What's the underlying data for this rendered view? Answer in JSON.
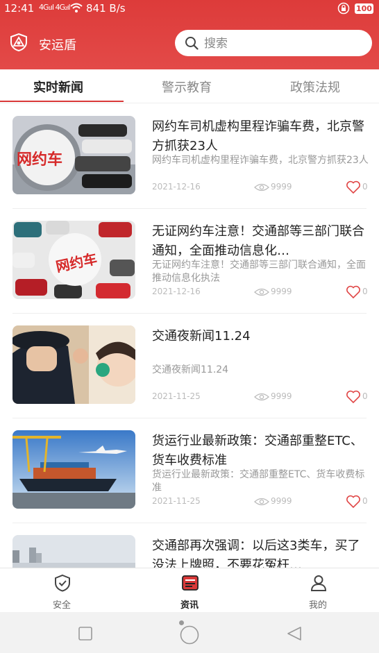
{
  "status_bar": {
    "time": "12:41",
    "signal": "4G₁ıl 4G₂ıl",
    "speed": "841 B/s",
    "battery": "100"
  },
  "header": {
    "app_name": "安运盾",
    "accent_color": "#dd3b3a",
    "logo_icon": "shield-logo-icon"
  },
  "search": {
    "placeholder": "搜索",
    "value": ""
  },
  "tabs": [
    {
      "label": "实时新闻",
      "active": true
    },
    {
      "label": "警示教育",
      "active": false
    },
    {
      "label": "政策法规",
      "active": false
    }
  ],
  "news": [
    {
      "title": "网约车司机虚构里程诈骗车费，北京警方抓获23人",
      "summary": "网约车司机虚构里程诈骗车费，北京警方抓获23人",
      "date": "2021-12-16",
      "views": "9999",
      "likes": "0",
      "thumb_text": "网约车"
    },
    {
      "title": "无证网约车注意！交通部等三部门联合通知，全面推动信息化…",
      "summary": "无证网约车注意！交通部等三部门联合通知，全面推动信息化执法",
      "date": "2021-12-16",
      "views": "9999",
      "likes": "0",
      "thumb_text": "网约车"
    },
    {
      "title": "交通夜新闻11.24",
      "summary": "交通夜新闻11.24",
      "date": "2021-11-25",
      "views": "9999",
      "likes": "0"
    },
    {
      "title": "货运行业最新政策：交通部重整ETC、货车收费标准",
      "summary": "货运行业最新政策：交通部重整ETC、货车收费标准",
      "date": "2021-11-25",
      "views": "9999",
      "likes": "0"
    },
    {
      "title": "交通部再次强调：以后这3类车，买了没法上牌照，不要花冤枉…",
      "summary": "",
      "date": "",
      "views": "",
      "likes": ""
    }
  ],
  "bottom_nav": [
    {
      "label": "安全",
      "icon": "shield-check-icon",
      "active": false
    },
    {
      "label": "资讯",
      "icon": "news-icon",
      "active": true
    },
    {
      "label": "我的",
      "icon": "user-icon",
      "active": false
    }
  ]
}
